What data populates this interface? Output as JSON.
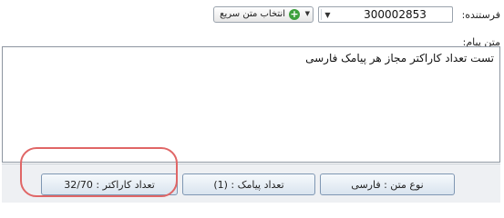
{
  "sender": {
    "label": "فرستنده:",
    "selected": "300002853"
  },
  "quick_text_button": {
    "label": "انتخاب متن سریع"
  },
  "message": {
    "label": "متن پیام:",
    "value": "تست تعداد کاراکتر مجاز هر پیامک فارسی"
  },
  "status": {
    "type_label": "نوع متن : فارسی",
    "sms_count_label": "تعداد پیامک : (1)",
    "char_count_label": "تعداد کاراکتر : 32/70"
  },
  "colors": {
    "highlight": "#e06666",
    "plus_icon": "#3da03d"
  }
}
